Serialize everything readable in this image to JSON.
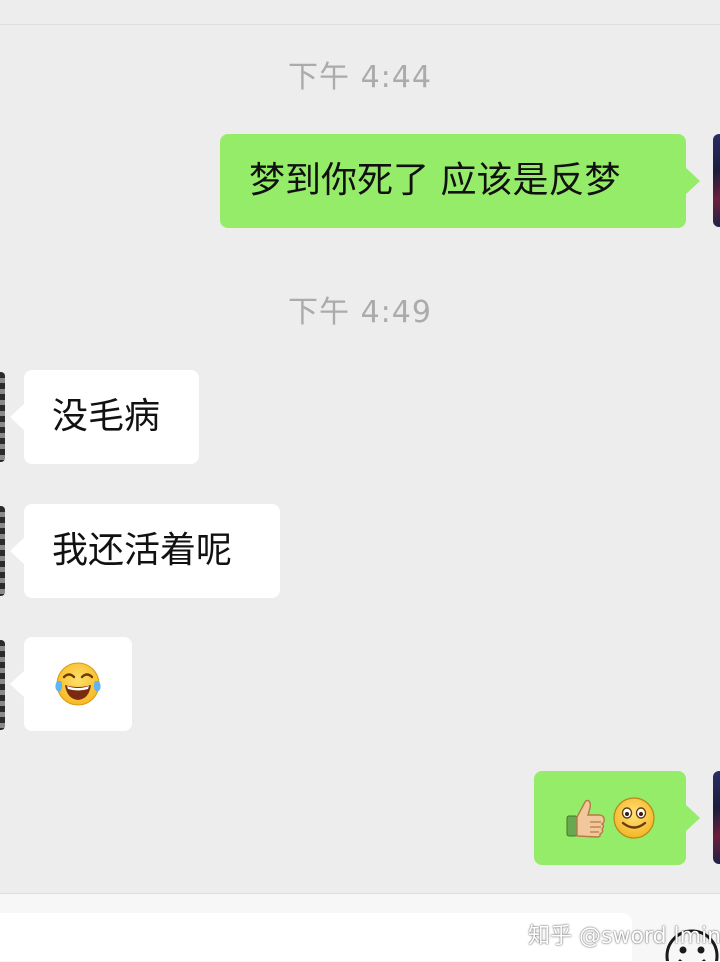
{
  "timestamps": [
    "下午 4:44",
    "下午 4:49"
  ],
  "messages": [
    {
      "side": "sent",
      "text": "梦到你死了 应该是反梦"
    },
    {
      "side": "received",
      "text": "没毛病"
    },
    {
      "side": "received",
      "text": "我还活着呢"
    },
    {
      "side": "received",
      "emoji": "laughing-tears-emoji"
    },
    {
      "side": "sent",
      "emoji": [
        "thumbs-up-emoji",
        "smile-emoji"
      ]
    }
  ],
  "watermark": "知乎 @sword lmin",
  "colors": {
    "background": "#ededed",
    "sent_bubble": "#95ec69",
    "received_bubble": "#ffffff",
    "timestamp": "#ababab"
  },
  "icons": [
    "emoji-button-icon"
  ]
}
